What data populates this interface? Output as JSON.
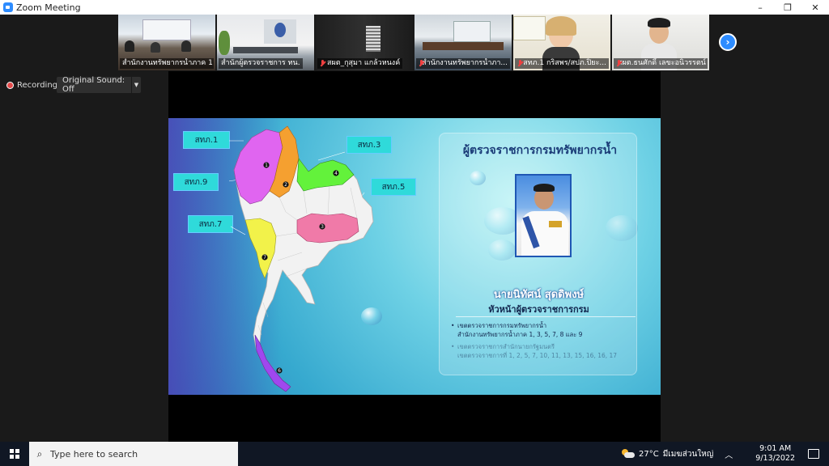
{
  "window": {
    "title": "Zoom Meeting",
    "controls": {
      "minimize": "–",
      "restore": "❐",
      "close": "✕"
    }
  },
  "gallery": {
    "tiles": [
      {
        "name": "สำนักงานทรัพยากรน้ำภาค 1",
        "muted": false,
        "active": false
      },
      {
        "name": "สำนักผู้ตรวจราชการ ทน.",
        "muted": false,
        "active": true
      },
      {
        "name": "สผต_กุสุมา แกล้วหนงค์",
        "muted": true,
        "active": false
      },
      {
        "name": "สำนักงานทรัพยากรน้ำภา...",
        "muted": true,
        "active": false
      },
      {
        "name": "สทภ.1 กริสพร/สปภ.ปิยะ...",
        "muted": true,
        "active": false
      },
      {
        "name": "สผต.ธนศักดิ์ เลขะอนิวรรตน์",
        "muted": true,
        "active": false
      }
    ],
    "next_page_icon": "chevron-right-icon"
  },
  "recording": {
    "label": "Recording"
  },
  "sound": {
    "label": "Original Sound: Off"
  },
  "slide": {
    "region_labels": [
      "สทภ.1",
      "สทภ.9",
      "สทภ.7",
      "สทภ.3",
      "สทภ.5"
    ],
    "map_numbers": [
      "1",
      "2",
      "3",
      "7",
      "4",
      "6"
    ],
    "colors": {
      "north_west": "#e065f0",
      "north": "#f5a030",
      "north_east_top": "#63f23b",
      "north_east_mid": "#f07aa8",
      "central": "#f2f24a",
      "south": "#a048ee",
      "base": "#f2f2f2"
    },
    "panel": {
      "title": "ผู้ตรวจราชการกรมทรัพยากรน้ำ",
      "name": "นายนิทัศน์ สุดดิพงษ์",
      "role": "หัวหน้าผู้ตรวจราชการกรม",
      "bullets": [
        {
          "line1": "เขตตรวจราชการกรมทรัพยากรน้ำ",
          "line2": "สำนักงานทรัพยากรน้ำภาค 1, 3, 5, 7, 8 และ 9"
        },
        {
          "line1": "เขตตรวจราชการสำนักนายกรัฐมนตรี",
          "line2": "เขตตรวจราชการที่ 1, 2, 5, 7, 10, 11, 13, 15, 16, 16, 17"
        }
      ]
    }
  },
  "taskbar": {
    "search_placeholder": "Type here to search",
    "temperature": "27°C",
    "weather_location": "มีเมฆส่วนใหญ่",
    "time": "9:01 AM",
    "date": "9/13/2022"
  }
}
